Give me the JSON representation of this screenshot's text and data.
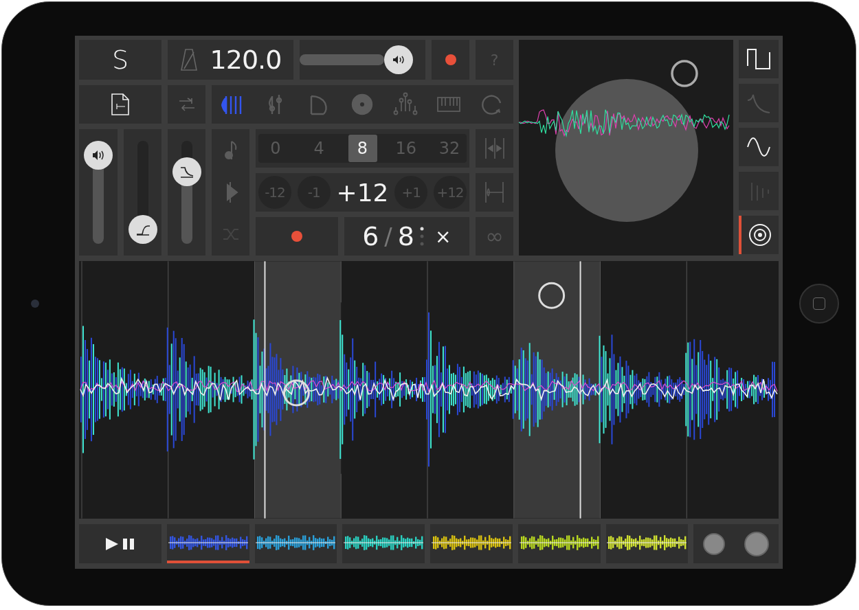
{
  "logo": {
    "text": "S"
  },
  "tempo": {
    "value": "120.0"
  },
  "master_volume": {
    "level": 0.86
  },
  "help": {
    "text": "?"
  },
  "mode_tabs": [
    {
      "kind": "sequencer",
      "selected": true
    },
    {
      "kind": "mixer",
      "selected": false
    },
    {
      "kind": "sampler",
      "selected": false
    },
    {
      "kind": "reel",
      "selected": false
    },
    {
      "kind": "effects",
      "selected": false
    },
    {
      "kind": "keys",
      "selected": false
    },
    {
      "kind": "loop",
      "selected": false
    }
  ],
  "sliders": [
    {
      "kind": "volume",
      "level": 1
    },
    {
      "kind": "attack",
      "level": 0
    },
    {
      "kind": "release",
      "level": 0.78
    }
  ],
  "side_tools": [
    {
      "kind": "note"
    },
    {
      "kind": "play"
    },
    {
      "kind": "shuffle"
    }
  ],
  "quantize": {
    "options": [
      {
        "label": "0",
        "selected": false
      },
      {
        "label": "4",
        "selected": false
      },
      {
        "label": "8",
        "selected": true
      },
      {
        "label": "16",
        "selected": false
      },
      {
        "label": "32",
        "selected": false
      }
    ]
  },
  "transpose": [
    {
      "kind": "button",
      "label": "-12"
    },
    {
      "kind": "button",
      "label": "-1"
    },
    {
      "kind": "value",
      "label": "+12"
    },
    {
      "kind": "button",
      "label": "+1"
    },
    {
      "kind": "button",
      "label": "+12"
    }
  ],
  "time_signature": {
    "numerator": "6",
    "separator": "/",
    "denominator": "8",
    "close": "×"
  },
  "loop_symbol": {
    "text": "∞"
  },
  "waveforms": [
    {
      "kind": "square",
      "enabled": true,
      "selected": false
    },
    {
      "kind": "decay",
      "enabled": false,
      "selected": false
    },
    {
      "kind": "sine",
      "enabled": true,
      "selected": false
    },
    {
      "kind": "bars",
      "enabled": false,
      "selected": false
    },
    {
      "kind": "target",
      "enabled": true,
      "selected": true
    }
  ],
  "clips": [
    {
      "color": "#3355e0",
      "selected": true
    },
    {
      "color": "#2a9fd8",
      "selected": false
    },
    {
      "color": "#2ad0c0",
      "selected": false
    },
    {
      "color": "#d8c010",
      "selected": false
    },
    {
      "color": "#b8d820",
      "selected": false
    },
    {
      "color": "#d0e030",
      "selected": false
    }
  ]
}
